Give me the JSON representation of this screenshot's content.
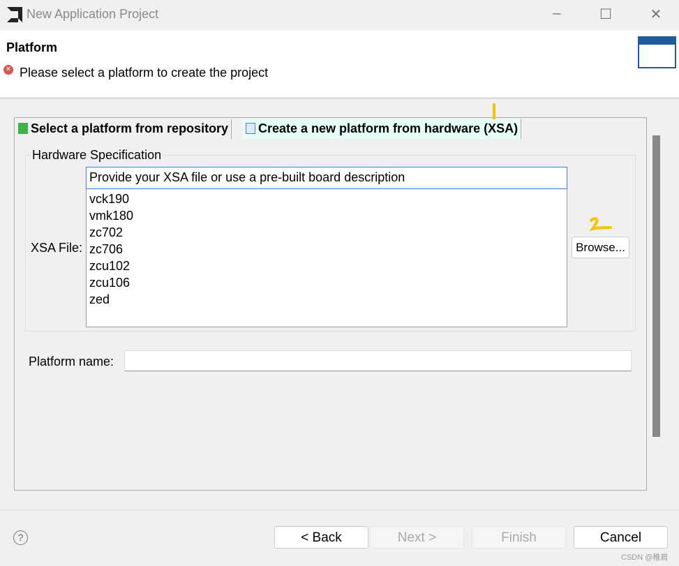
{
  "window": {
    "title": "New Application Project"
  },
  "header": {
    "title": "Platform",
    "message": "Please select a platform to create the project"
  },
  "tabs": [
    {
      "label": "Select a platform from repository",
      "active": false
    },
    {
      "label": "Create a new platform from hardware (XSA)",
      "active": true
    }
  ],
  "hardware": {
    "group_label": "Hardware Specification",
    "xsa_label": "XSA File:",
    "combo_value": "Provide your XSA file or use a pre-built board description",
    "boards": [
      "vck190",
      "vmk180",
      "zc702",
      "zc706",
      "zcu102",
      "zcu106",
      "zed"
    ],
    "browse_label": "Browse..."
  },
  "platform_name": {
    "label": "Platform name:",
    "value": ""
  },
  "footer": {
    "back": "< Back",
    "next": "Next >",
    "finish": "Finish",
    "cancel": "Cancel"
  },
  "watermark": "CSDN @稚肩",
  "colors": {
    "accent": "#1e5b9c",
    "annotation": "#f5c400",
    "error": "#d9534f"
  }
}
